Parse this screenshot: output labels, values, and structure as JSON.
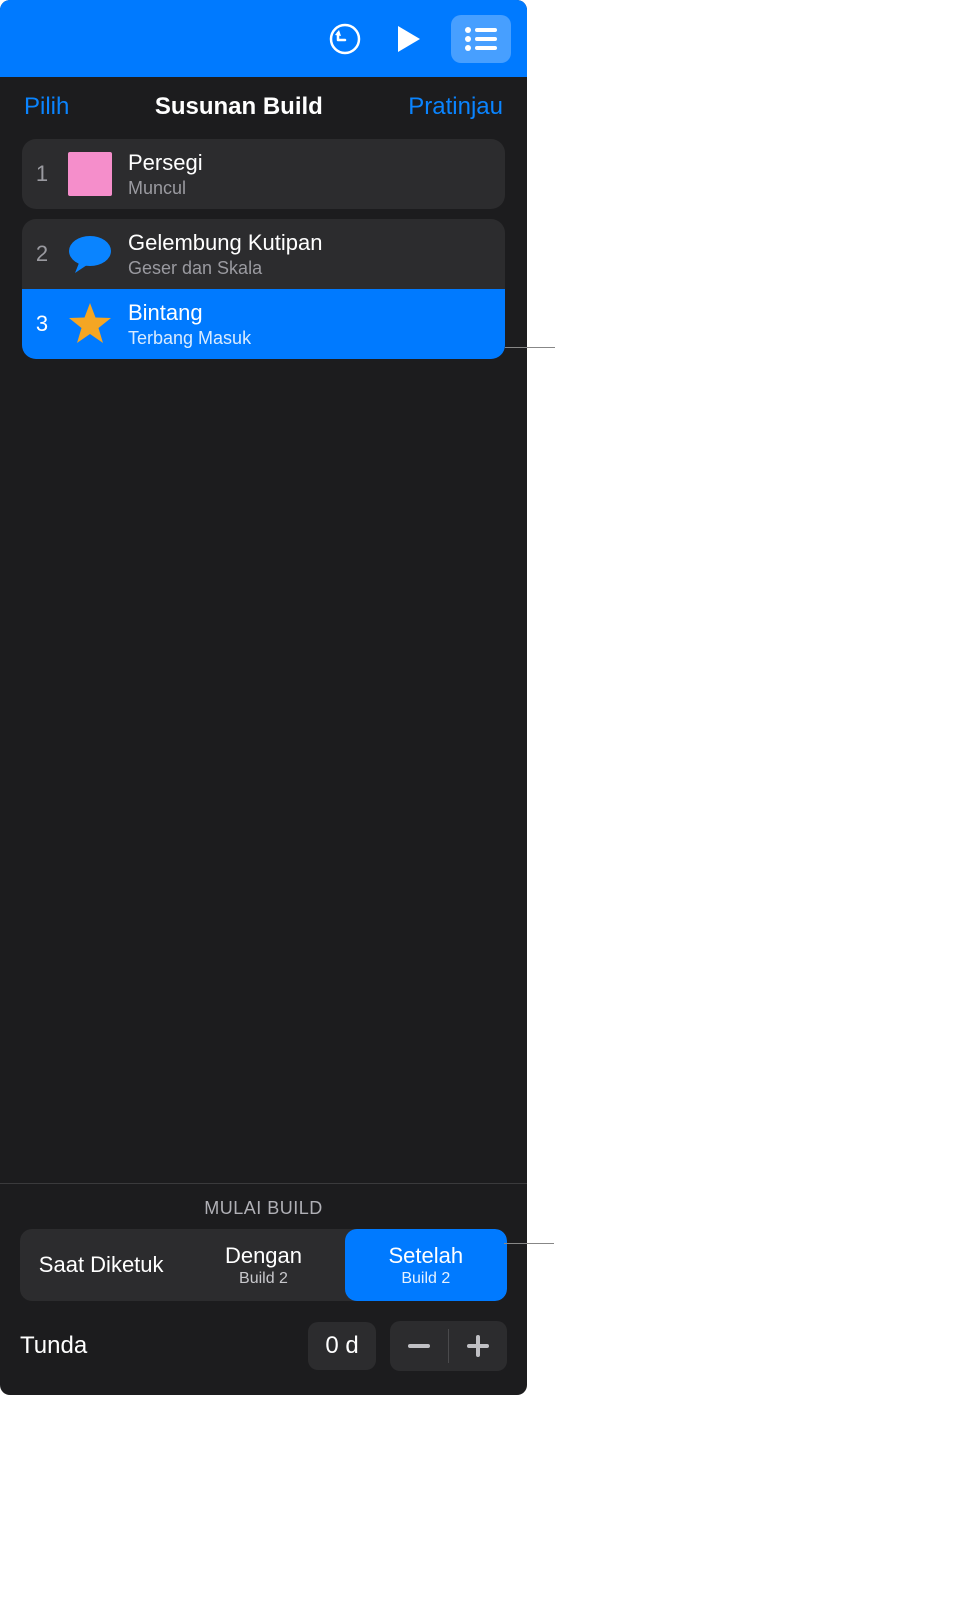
{
  "header": {
    "select": "Pilih",
    "title": "Susunan Build",
    "preview": "Pratinjau"
  },
  "builds": [
    {
      "num": "1",
      "title": "Persegi",
      "sub": "Muncul",
      "icon": "square",
      "selected": false
    },
    {
      "num": "2",
      "title": "Gelembung Kutipan",
      "sub": "Geser dan Skala",
      "icon": "speech",
      "selected": false
    },
    {
      "num": "3",
      "title": "Bintang",
      "sub": "Terbang Masuk",
      "icon": "star",
      "selected": true
    }
  ],
  "bottom": {
    "label": "MULAI BUILD",
    "segments": [
      {
        "title": "Saat Diketuk",
        "sub": "",
        "selected": false
      },
      {
        "title": "Dengan",
        "sub": "Build 2",
        "selected": false
      },
      {
        "title": "Setelah",
        "sub": "Build 2",
        "selected": true
      }
    ],
    "delay_label": "Tunda",
    "delay_value": "0 d"
  }
}
